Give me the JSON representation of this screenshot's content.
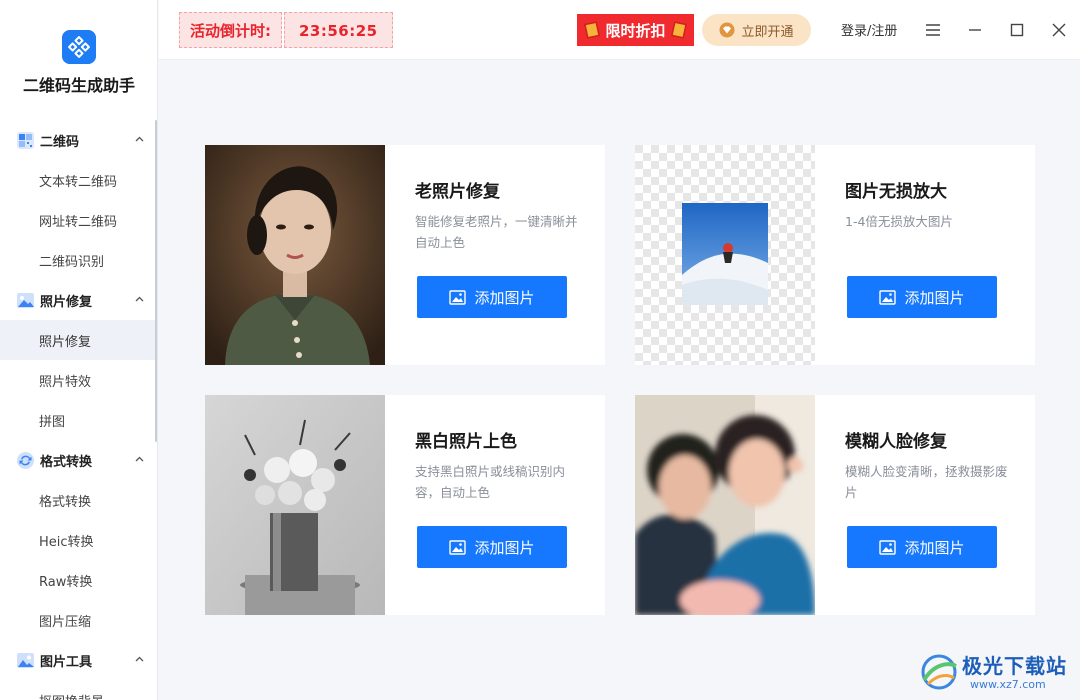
{
  "app": {
    "name": "二维码生成助手"
  },
  "topbar": {
    "promo_label": "活动倒计时:",
    "promo_time": "23:56:25",
    "discount_label": "限时折扣",
    "vip_label": "立即开通",
    "login_label": "登录/注册"
  },
  "sidebar": {
    "groups": [
      {
        "label": "二维码",
        "icon": "qrcode-icon",
        "items": [
          "文本转二维码",
          "网址转二维码",
          "二维码识别"
        ]
      },
      {
        "label": "照片修复",
        "icon": "photo-icon",
        "items": [
          "照片修复",
          "照片特效",
          "拼图"
        ]
      },
      {
        "label": "格式转换",
        "icon": "convert-icon",
        "items": [
          "格式转换",
          "Heic转换",
          "Raw转换",
          "图片压缩"
        ]
      },
      {
        "label": "图片工具",
        "icon": "image-tools-icon",
        "items": [
          "抠图换背景"
        ]
      }
    ],
    "active_item": "照片修复"
  },
  "cards": [
    {
      "title": "老照片修复",
      "desc": "智能修复老照片，一键清晰并自动上色",
      "button": "添加图片"
    },
    {
      "title": "图片无损放大",
      "desc": "1-4倍无损放大图片",
      "button": "添加图片"
    },
    {
      "title": "黑白照片上色",
      "desc": "支持黑白照片或线稿识别内容，自动上色",
      "button": "添加图片"
    },
    {
      "title": "模糊人脸修复",
      "desc": "模糊人脸变清晰，拯救摄影废片",
      "button": "添加图片"
    }
  ],
  "watermark": {
    "text": "极光下载站",
    "url": "www.xz7.com"
  },
  "colors": {
    "primary": "#1677ff",
    "promo_red": "#e8242b",
    "vip_gold": "#fbe3c6",
    "sidebar_active": "#eef1f8"
  }
}
